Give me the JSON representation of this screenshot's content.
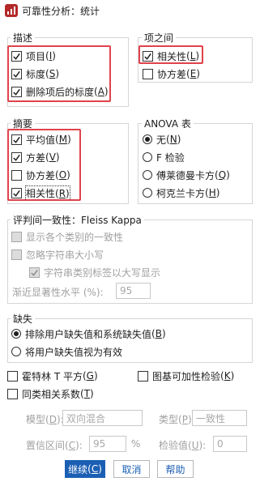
{
  "window": {
    "title": "可靠性分析：统计"
  },
  "describe": {
    "legend": "描述",
    "items": [
      {
        "label": "项目",
        "key": "I",
        "checked": true
      },
      {
        "label": "标度",
        "key": "S",
        "checked": true
      },
      {
        "label": "删除项后的标度",
        "key": "A",
        "checked": true
      }
    ]
  },
  "between_items": {
    "legend": "项之间",
    "items": [
      {
        "label": "相关性",
        "key": "L",
        "checked": true
      },
      {
        "label": "协方差",
        "key": "E",
        "checked": false
      }
    ]
  },
  "summary": {
    "legend": "摘要",
    "items": [
      {
        "label": "平均值",
        "key": "M",
        "checked": true
      },
      {
        "label": "方差",
        "key": "V",
        "checked": true
      },
      {
        "label": "协方差",
        "key": "O",
        "checked": false
      },
      {
        "label": "相关性",
        "key": "R",
        "checked": true
      }
    ]
  },
  "anova": {
    "legend": "ANOVA 表",
    "options": [
      {
        "label": "无",
        "key": "N",
        "selected": true
      },
      {
        "label": "F 检验",
        "key": "F",
        "selected": false
      },
      {
        "label": "傅莱德曼卡方",
        "key": "Q",
        "selected": false
      },
      {
        "label": "柯克兰卡方",
        "key": "H",
        "selected": false
      }
    ]
  },
  "fleiss": {
    "legend": "评判间一致性：Fleiss Kappa",
    "show_each": "显示各个类别的一致性",
    "ignore_case": "忽略字符串大小写",
    "uppercase": "字符串类别标签以大写显示",
    "sig_label": "渐近显著性水平 (%):",
    "sig_value": "95"
  },
  "missing": {
    "legend": "缺失",
    "options": [
      {
        "label": "排除用户缺失值和系统缺失值",
        "key": "B",
        "selected": true
      },
      {
        "label": "将用户缺失值视为有效",
        "key": "",
        "selected": false
      }
    ]
  },
  "extra": {
    "hotelling": {
      "label": "霍特林 T 平方",
      "key": "G"
    },
    "tukey": {
      "label": "图基可加性检验",
      "key": "K"
    },
    "icc": {
      "label": "同类相关系数",
      "key": "T"
    }
  },
  "icc_settings": {
    "model_label": "模型",
    "model_key": "D",
    "model_value": "双向混合",
    "type_label": "类型",
    "type_key": "P",
    "type_value": "一致性",
    "ci_label": "置信区间",
    "ci_key": "C",
    "ci_value": "95",
    "percent": "%",
    "test_label": "检验值",
    "test_key": "U",
    "test_value": "0"
  },
  "buttons": {
    "continue": {
      "label": "继续",
      "key": "C"
    },
    "cancel": "取消",
    "help": "帮助"
  },
  "colors": {
    "highlight": "#e0424b",
    "primary": "#1b5fb4"
  }
}
